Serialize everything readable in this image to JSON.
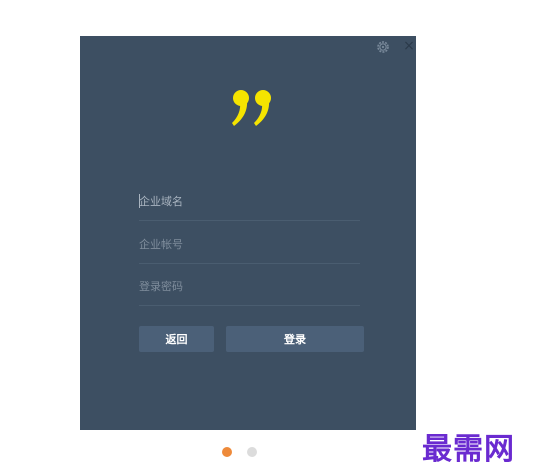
{
  "login": {
    "domain_placeholder": "企业域名",
    "account_placeholder": "企业帐号",
    "password_placeholder": "登录密码",
    "domain_value": "",
    "account_value": "",
    "password_value": ""
  },
  "buttons": {
    "back_label": "返回",
    "login_label": "登录"
  },
  "icons": {
    "settings": "gear-icon",
    "close": "close-icon",
    "logo": "quote-mark-logo",
    "close_glyph": "×"
  },
  "carousel": {
    "active_index": 0,
    "count": 2
  },
  "watermark": {
    "text": "最需网"
  },
  "colors": {
    "panel_bg": "#3d4f62",
    "accent_yellow": "#f5e400",
    "button_bg": "#4b6078",
    "active_dot": "#ee8a3a",
    "watermark": "#6a2ad0"
  }
}
